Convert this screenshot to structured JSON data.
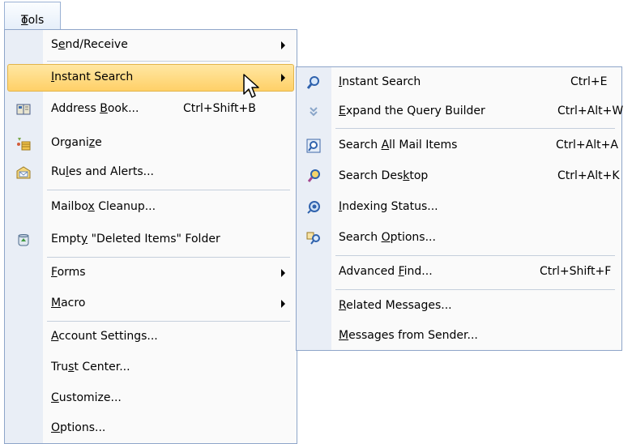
{
  "menubar": {
    "tools_label": "Tools",
    "tools_mnemonic": "T",
    "tools_rest": "ools"
  },
  "tools_menu": {
    "items": [
      {
        "pre": "S",
        "m": "e",
        "post": "nd/Receive",
        "submenu": true
      },
      {
        "pre": "",
        "m": "I",
        "post": "nstant Search",
        "submenu": true,
        "highlighted": true
      },
      {
        "pre": "Address ",
        "m": "B",
        "post": "ook...",
        "shortcut": "Ctrl+Shift+B",
        "icon": "address-book-icon"
      },
      {
        "pre": "Organi",
        "m": "z",
        "post": "e",
        "icon": "organize-icon"
      },
      {
        "pre": "Ru",
        "m": "l",
        "post": "es and Alerts...",
        "icon": "rules-alerts-icon"
      },
      {
        "pre": "Mailbo",
        "m": "x",
        "post": " Cleanup..."
      },
      {
        "pre": "Empt",
        "m": "y",
        "post": " \"Deleted Items\" Folder",
        "icon": "recycle-bin-icon"
      },
      {
        "pre": "",
        "m": "F",
        "post": "orms",
        "submenu": true
      },
      {
        "pre": "",
        "m": "M",
        "post": "acro",
        "submenu": true
      },
      {
        "pre": "",
        "m": "A",
        "post": "ccount Settings..."
      },
      {
        "pre": "Tru",
        "m": "s",
        "post": "t Center..."
      },
      {
        "pre": "",
        "m": "C",
        "post": "ustomize..."
      },
      {
        "pre": "",
        "m": "O",
        "post": "ptions..."
      }
    ]
  },
  "submenu": {
    "items": [
      {
        "pre": "",
        "m": "I",
        "post": "nstant Search",
        "shortcut": "Ctrl+E",
        "icon": "search-magnifier-icon"
      },
      {
        "pre": "",
        "m": "E",
        "post": "xpand the Query Builder",
        "shortcut": "Ctrl+Alt+W",
        "icon": "expand-chevron-icon"
      },
      {
        "pre": "Search ",
        "m": "A",
        "post": "ll Mail Items",
        "shortcut": "Ctrl+Alt+A",
        "icon": "search-mail-icon"
      },
      {
        "pre": "Search Des",
        "m": "k",
        "post": "top",
        "shortcut": "Ctrl+Alt+K",
        "icon": "search-desktop-icon"
      },
      {
        "pre": "",
        "m": "I",
        "post": "ndexing Status...",
        "icon": "indexing-status-icon"
      },
      {
        "pre": "Search ",
        "m": "O",
        "post": "ptions...",
        "icon": "search-options-icon"
      },
      {
        "pre": "Advanced ",
        "m": "F",
        "post": "ind...",
        "shortcut": "Ctrl+Shift+F"
      },
      {
        "pre": "",
        "m": "R",
        "post": "elated Messages..."
      },
      {
        "pre": "",
        "m": "M",
        "post": "essages from Sender..."
      }
    ]
  },
  "colors": {
    "highlight": "#ffd067",
    "gutter": "#e9eef6",
    "border": "#8ea5c9"
  }
}
